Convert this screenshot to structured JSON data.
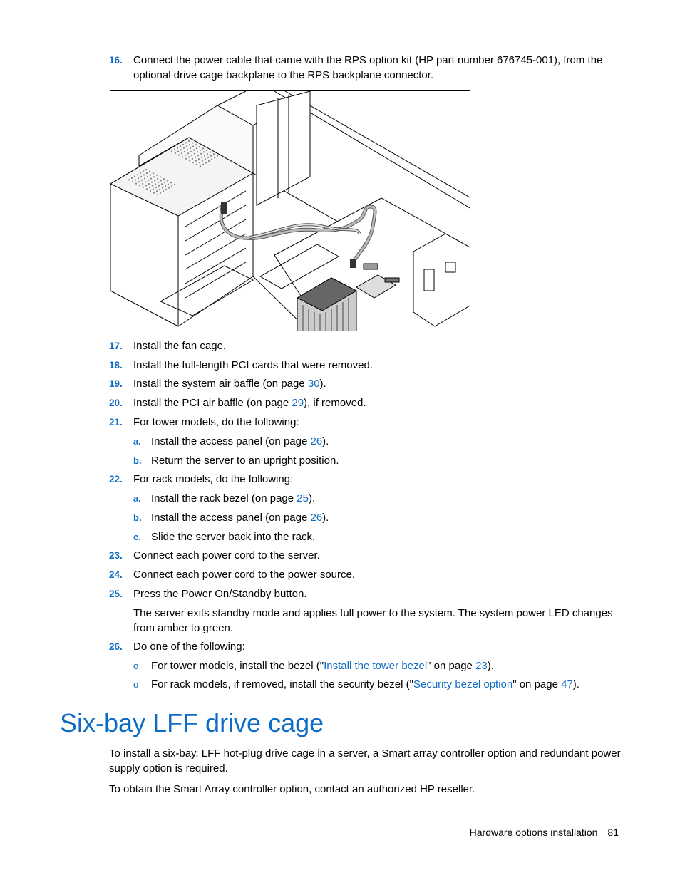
{
  "steps": {
    "s16": {
      "num": "16.",
      "text_a": "Connect the power cable that came with the RPS option kit (HP part number 676745-001), from the",
      "text_b": "optional drive cage backplane to the RPS backplane connector."
    },
    "s17": {
      "num": "17.",
      "text": "Install the fan cage."
    },
    "s18": {
      "num": "18.",
      "text": "Install the full-length PCI cards that were removed."
    },
    "s19": {
      "num": "19.",
      "pre": "Install the system air baffle (on page ",
      "link": "30",
      "post": ")."
    },
    "s20": {
      "num": "20.",
      "pre": "Install the PCI air baffle (on page ",
      "link": "29",
      "post": "), if removed."
    },
    "s21": {
      "num": "21.",
      "text": "For tower models, do the following:",
      "a": {
        "num": "a.",
        "pre": "Install the access panel (on page ",
        "link": "26",
        "post": ")."
      },
      "b": {
        "num": "b.",
        "text": "Return the server to an upright position."
      }
    },
    "s22": {
      "num": "22.",
      "text": "For rack models, do the following:",
      "a": {
        "num": "a.",
        "pre": "Install the rack bezel (on page ",
        "link": "25",
        "post": ")."
      },
      "b": {
        "num": "b.",
        "pre": "Install the access panel (on page ",
        "link": "26",
        "post": ")."
      },
      "c": {
        "num": "c.",
        "text": "Slide the server back into the rack."
      }
    },
    "s23": {
      "num": "23.",
      "text": "Connect each power cord to the server."
    },
    "s24": {
      "num": "24.",
      "text": "Connect each power cord to the power source."
    },
    "s25": {
      "num": "25.",
      "text": "Press the Power On/Standby button.",
      "note": "The server exits standby mode and applies full power to the system. The system power LED changes from amber to green."
    },
    "s26": {
      "num": "26.",
      "text": "Do one of the following:",
      "b1": {
        "bullet": "o",
        "pre": "For tower models, install the bezel (\"",
        "link": "Install the tower bezel",
        "mid": "\" on page ",
        "page": "23",
        "post": ")."
      },
      "b2": {
        "bullet": "o",
        "pre": "For rack models, if removed, install the security bezel (\"",
        "link": "Security bezel option",
        "mid": "\" on page ",
        "page": "47",
        "post": ")."
      }
    }
  },
  "figure": {
    "description": "Isometric line drawing of server chassis showing the RPS power cable routed from the optional drive cage backplane to the RPS backplane connector"
  },
  "section": {
    "title": "Six-bay LFF drive cage",
    "para1": "To install a six-bay, LFF hot-plug drive cage in a server, a Smart array controller option and redundant power supply option is required.",
    "para2": "To obtain the Smart Array controller option, contact an authorized HP reseller."
  },
  "footer": {
    "chapter": "Hardware options installation",
    "page": "81"
  },
  "colors": {
    "accent": "#0F6CC4",
    "text": "#000000"
  }
}
